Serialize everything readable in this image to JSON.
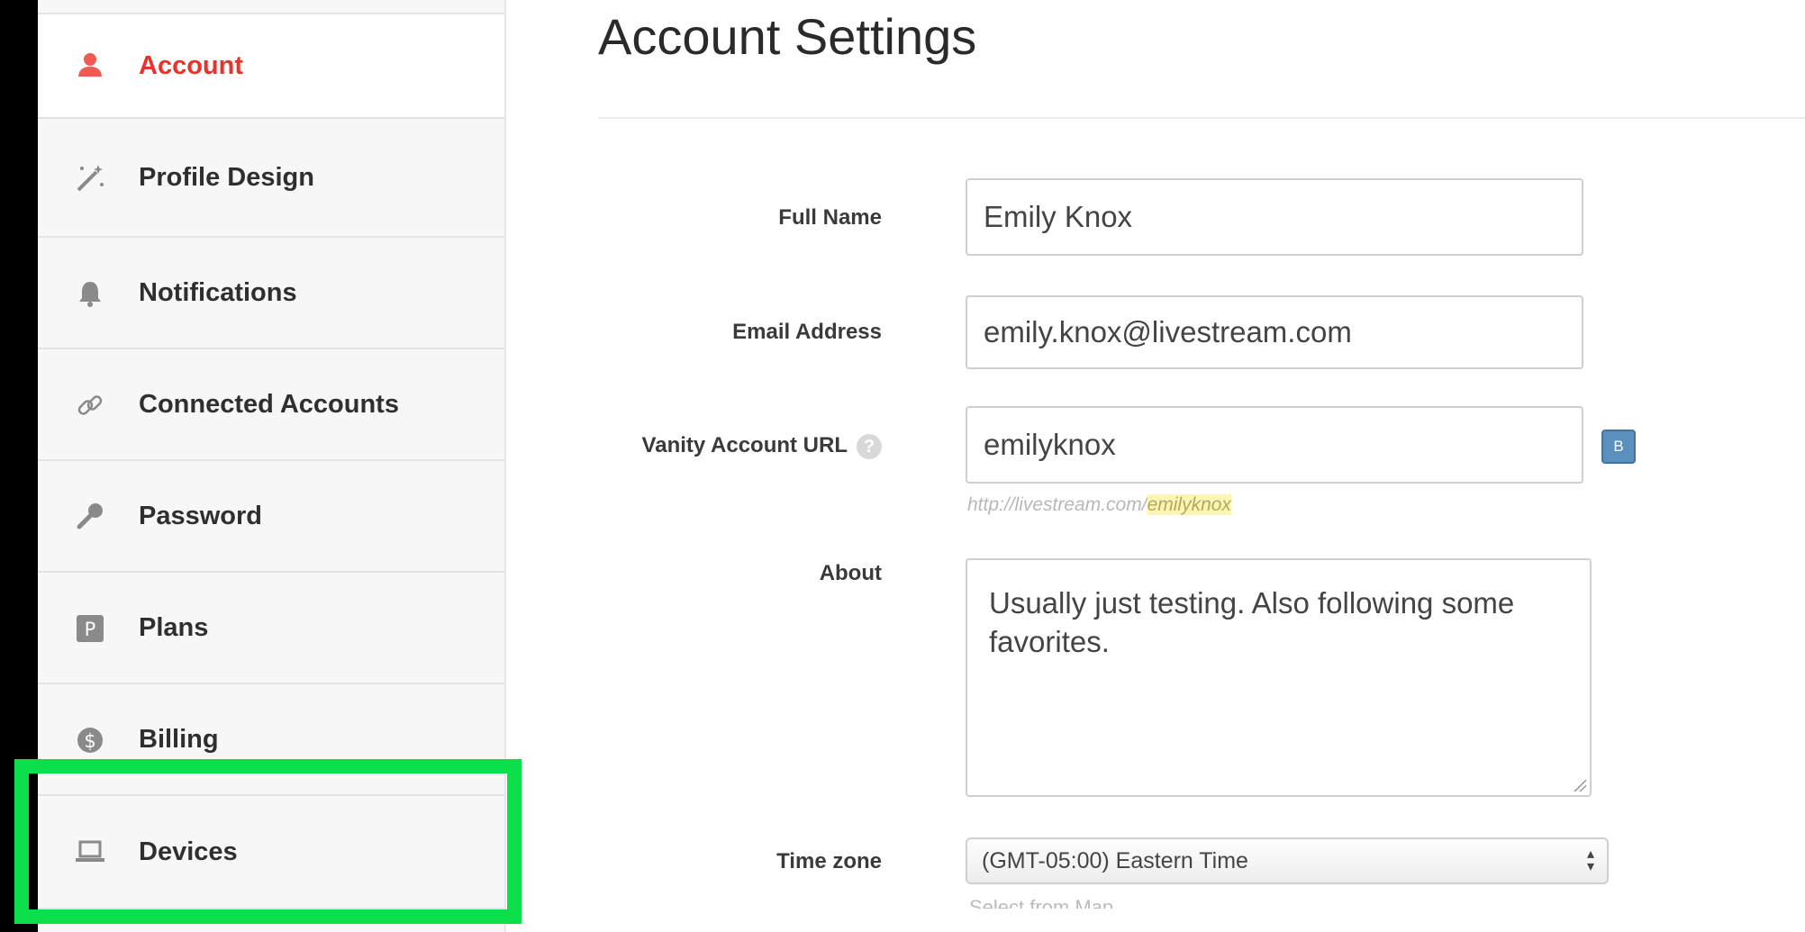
{
  "page": {
    "title": "Account Settings"
  },
  "sidebar": {
    "items": [
      {
        "label": "Account",
        "icon": "user-icon",
        "active": true
      },
      {
        "label": "Profile Design",
        "icon": "magic-wand-icon",
        "active": false
      },
      {
        "label": "Notifications",
        "icon": "bell-icon",
        "active": false
      },
      {
        "label": "Connected Accounts",
        "icon": "link-icon",
        "active": false
      },
      {
        "label": "Password",
        "icon": "key-icon",
        "active": false
      },
      {
        "label": "Plans",
        "icon": "plans-p-icon",
        "active": false
      },
      {
        "label": "Billing",
        "icon": "dollar-circle-icon",
        "active": false
      },
      {
        "label": "Devices",
        "icon": "laptop-icon",
        "active": false
      }
    ]
  },
  "form": {
    "full_name": {
      "label": "Full Name",
      "value": "Emily Knox"
    },
    "email": {
      "label": "Email Address",
      "value": "emily.knox@livestream.com"
    },
    "vanity": {
      "label": "Vanity Account URL",
      "value": "emilyknox",
      "badge": "B",
      "url_prefix": "http://livestream.com/",
      "url_slug": "emilyknox"
    },
    "about": {
      "label": "About",
      "value": "Usually just testing. Also following some favorites."
    },
    "timezone": {
      "label": "Time zone",
      "value": "(GMT-05:00) Eastern Time",
      "hint": "Select from Map"
    }
  },
  "colors": {
    "active": "#e8322b",
    "highlight": "#0be04a",
    "badge": "#5b8fbd"
  }
}
